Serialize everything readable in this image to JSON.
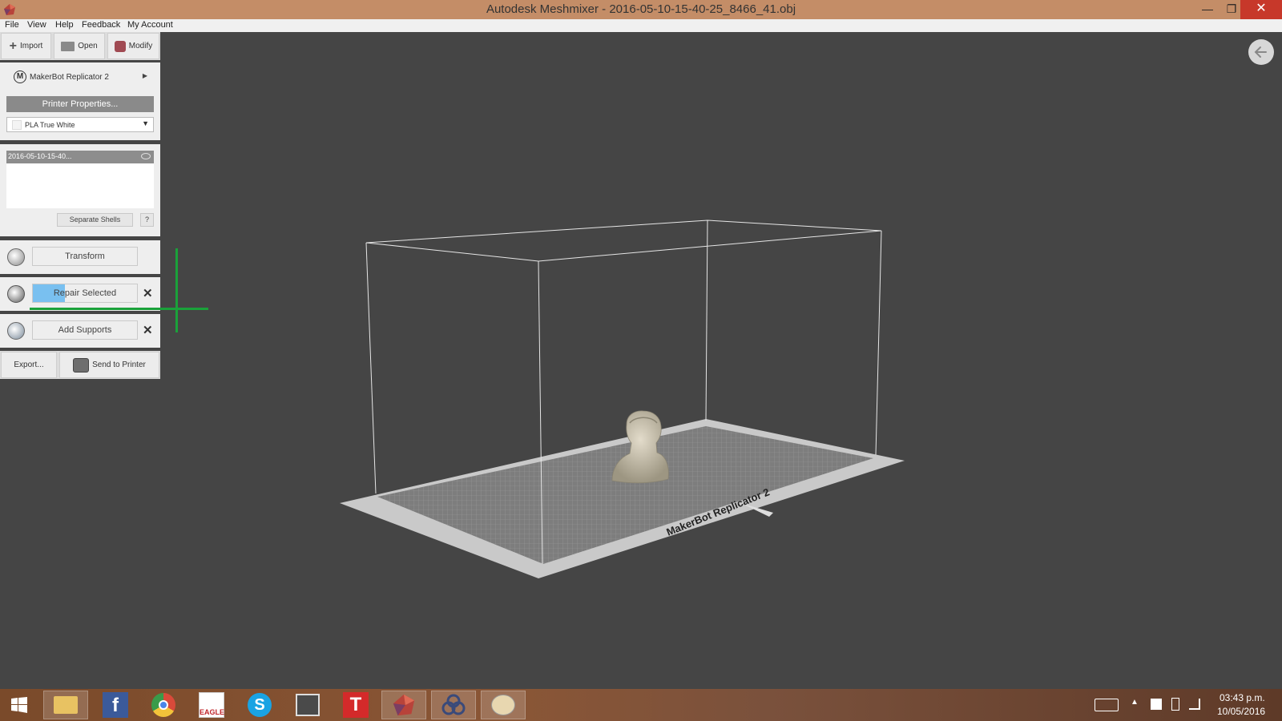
{
  "window": {
    "title": "Autodesk Meshmixer - 2016-05-10-15-40-25_8466_41.obj",
    "minimize": "—",
    "maximize": "❐",
    "close": "✕"
  },
  "menu": [
    "File",
    "View",
    "Help",
    "Feedback",
    "My Account"
  ],
  "toolbar": {
    "import_label": "Import",
    "open_label": "Open",
    "modify_label": "Modify"
  },
  "printer": {
    "name": "MakerBot Replicator 2",
    "properties_button": "Printer Properties...",
    "material": "PLA True White"
  },
  "objects": {
    "item_name": "2016-05-10-15-40...",
    "separate_shells_label": "Separate Shells",
    "help_label": "?"
  },
  "tools": {
    "transform_label": "Transform",
    "repair_label": "Repair Selected",
    "add_supports_label": "Add Supports"
  },
  "bottom_actions": {
    "export_label": "Export...",
    "send_label": "Send to Printer"
  },
  "scene": {
    "plate_label": "MakerBot Replicator 2"
  },
  "taskbar": {
    "time": "03:43 p.m.",
    "date": "10/05/2016",
    "apps": [
      "start-icon",
      "file-explorer-icon",
      "facebook-icon",
      "chrome-icon",
      "eagle-icon",
      "skype-icon",
      "presentation-icon",
      "t-app-icon",
      "meshmixer-icon",
      "circles-app-icon",
      "paint-icon"
    ]
  },
  "colors": {
    "titlebar": "#c48d67",
    "viewport": "#454545",
    "close": "#c7382a",
    "cursor_green": "#1aa13a",
    "selection_blue": "#79c0f0"
  }
}
